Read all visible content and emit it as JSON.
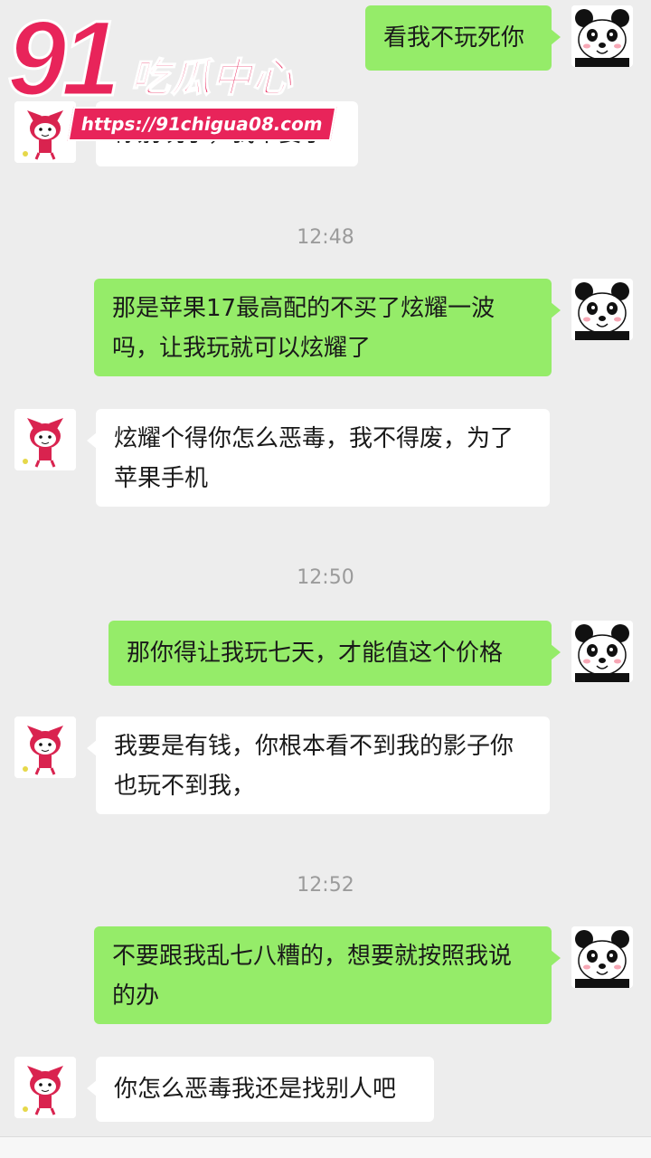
{
  "watermark": {
    "number": "91",
    "text": "吃瓜中心",
    "url": "https://91chigua08.com"
  },
  "messages": [
    {
      "from": "me",
      "text": "看我不玩死你"
    },
    {
      "from": "them",
      "text": "你别玩了，我不要了"
    },
    {
      "time": "12:48"
    },
    {
      "from": "me",
      "text": "那是苹果17最高配的不买了炫耀一波吗，让我玩就可以炫耀了"
    },
    {
      "from": "them",
      "text": "炫耀个得你怎么恶毒，我不得废，为了苹果手机"
    },
    {
      "time": "12:50"
    },
    {
      "from": "me",
      "text": "那你得让我玩七天，才能值这个价格"
    },
    {
      "from": "them",
      "text": "我要是有钱，你根本看不到我的影子你也玩不到我，"
    },
    {
      "time": "12:52"
    },
    {
      "from": "me",
      "text": "不要跟我乱七八糟的，想要就按照我说的办"
    },
    {
      "from": "them",
      "text": "你怎么恶毒我还是找别人吧"
    }
  ],
  "colors": {
    "my_bubble": "#95ec69",
    "their_bubble": "#ffffff",
    "background": "#ededed",
    "watermark": "#e8245a"
  },
  "icons": {
    "my_avatar": "panda-avatar-icon",
    "their_avatar": "cartoon-fox-avatar-icon"
  }
}
